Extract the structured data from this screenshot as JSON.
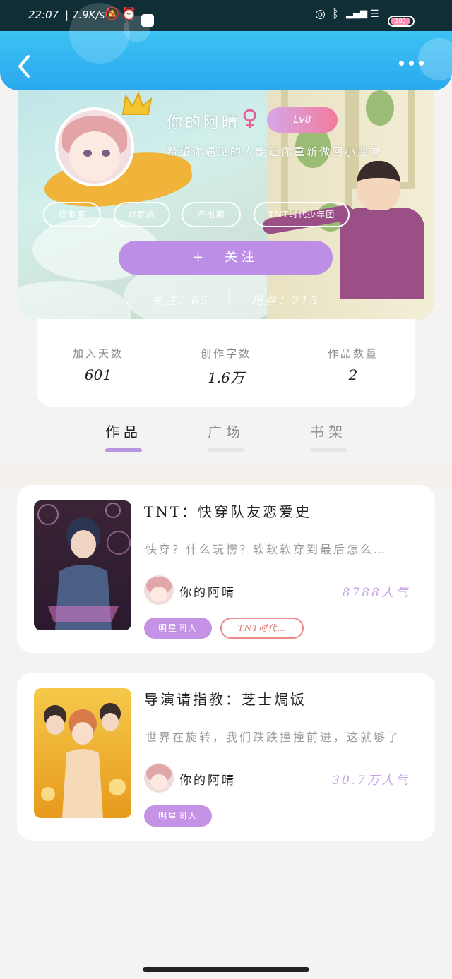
{
  "status_bar": {
    "time": "22:07",
    "network_speed": "7.9K/s",
    "icons": [
      "bell-muted-icon",
      "alarm-icon",
      "message-icon",
      "hotspot-icon",
      "bluetooth-icon",
      "signal-icon",
      "wifi-icon",
      "battery-icon"
    ],
    "battery": "100"
  },
  "nav": {
    "back_icon": "chevron-left-icon",
    "more_icon": "more-dots-icon"
  },
  "profile": {
    "username": "你的阿晴",
    "gender_symbol": "♀",
    "level": "Lv8",
    "motto": "希望你遇见的人能让你重新做回小朋友",
    "tags": [
      "双鱼座",
      "tf家族",
      "产出期",
      "TNT时代少年团"
    ],
    "follow_label": "+　关注",
    "following": "关注：65",
    "fans": "粉丝：213"
  },
  "stats": [
    {
      "label": "加入天数",
      "value": "601"
    },
    {
      "label": "创作字数",
      "value": "1.6万"
    },
    {
      "label": "作品数量",
      "value": "2"
    }
  ],
  "tabs": [
    {
      "label": "作品",
      "active": true
    },
    {
      "label": "广场",
      "active": false
    },
    {
      "label": "书架",
      "active": false
    }
  ],
  "works": [
    {
      "title": "TNT：快穿队友恋爱史",
      "description": "快穿？什么玩愣？软软软穿到最后怎么…",
      "author": "你的阿晴",
      "popularity": "8788人气",
      "chips": [
        "明星同人",
        "TNT时代…"
      ]
    },
    {
      "title": "导演请指教：芝士焗饭",
      "description": "世界在旋转，我们跌跌撞撞前进，这就够了",
      "author": "你的阿晴",
      "popularity": "30.7万人气",
      "chips": [
        "明星同人"
      ]
    }
  ],
  "colors": {
    "nav_blue": "#2aa8ee",
    "accent_purple": "#bd8ee6",
    "popularity_purple": "#c9a3ea",
    "chip_red": "#e07373"
  }
}
